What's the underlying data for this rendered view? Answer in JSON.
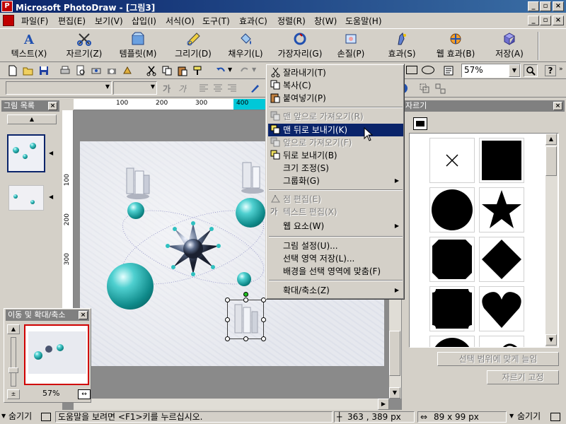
{
  "window": {
    "title": "Microsoft PhotoDraw - [그림3]"
  },
  "menubar": {
    "items": [
      "파일(F)",
      "편집(E)",
      "보기(V)",
      "삽입(I)",
      "서식(O)",
      "도구(T)",
      "효과(C)",
      "정렬(R)",
      "창(W)",
      "도움말(H)"
    ]
  },
  "bigtoolbar": {
    "buttons": [
      "텍스트(X)",
      "자르기(Z)",
      "템플릿(M)",
      "그리기(D)",
      "채우기(L)",
      "가장자리(G)",
      "손질(P)",
      "효과(S)",
      "웹 효과(B)",
      "저장(A)"
    ]
  },
  "stdtoolbar": {
    "zoom": "57%"
  },
  "picture_list": {
    "title": "그림 목록"
  },
  "ruler": {
    "labels": [
      "100",
      "200",
      "300",
      "400",
      "100",
      "200",
      "300"
    ]
  },
  "context_menu": {
    "items": [
      {
        "label": "잘라내기(T)",
        "icon": "scissors-icon",
        "enabled": true
      },
      {
        "label": "복사(C)",
        "icon": "copy-icon",
        "enabled": true
      },
      {
        "label": "붙여넣기(P)",
        "icon": "paste-icon",
        "enabled": true
      },
      {
        "label": "맨 앞으로 가져오기(R)",
        "icon": "bring-to-front-icon",
        "enabled": false
      },
      {
        "label": "맨 뒤로 보내기(K)",
        "icon": "send-to-back-icon",
        "enabled": true,
        "highlighted": true
      },
      {
        "label": "앞으로 가져오기(F)",
        "icon": "bring-forward-icon",
        "enabled": false
      },
      {
        "label": "뒤로 보내기(B)",
        "icon": "send-backward-icon",
        "enabled": true
      },
      {
        "label": "크기 조정(S)",
        "enabled": true
      },
      {
        "label": "그룹화(G)",
        "enabled": true,
        "submenu": true
      },
      {
        "label": "점 편집(E)",
        "icon": "edit-points-icon",
        "enabled": false
      },
      {
        "label": "텍스트 편집(X)",
        "icon": "edit-text-icon",
        "enabled": false
      },
      {
        "label": "웹 요소(W)",
        "enabled": true,
        "submenu": true
      },
      {
        "label": "그림 설정(U)...",
        "enabled": true
      },
      {
        "label": "선택 영역 저장(L)...",
        "enabled": true
      },
      {
        "label": "배경을 선택 영역에 맞춤(F)",
        "enabled": true
      },
      {
        "label": "확대/축소(Z)",
        "enabled": true,
        "submenu": true
      }
    ]
  },
  "crop_panel": {
    "title": "자르기",
    "shapes": [
      "x-mark-icon",
      "square-icon",
      "circle-icon",
      "star-icon",
      "octagon-icon",
      "diamond-icon",
      "stamp-icon",
      "heart-icon"
    ],
    "fit_button": "선택 범위에 맞게 늘임",
    "fix_button": "자르기 고정"
  },
  "pan_zoom": {
    "title": "이동 및 확대/축소",
    "zoom": "57%"
  },
  "statusbar": {
    "hide_left": "숨기기",
    "help_text": "도움말을 보려면 <F1>키를 누르십시오.",
    "coords": "363 , 389 px",
    "size": "89 x 99 px",
    "hide_right": "숨기기"
  },
  "colors": {
    "title_bar": "#0a246a",
    "highlight": "#0a246a",
    "sphere": "#1fa8a8",
    "accent_red": "#c00000"
  }
}
